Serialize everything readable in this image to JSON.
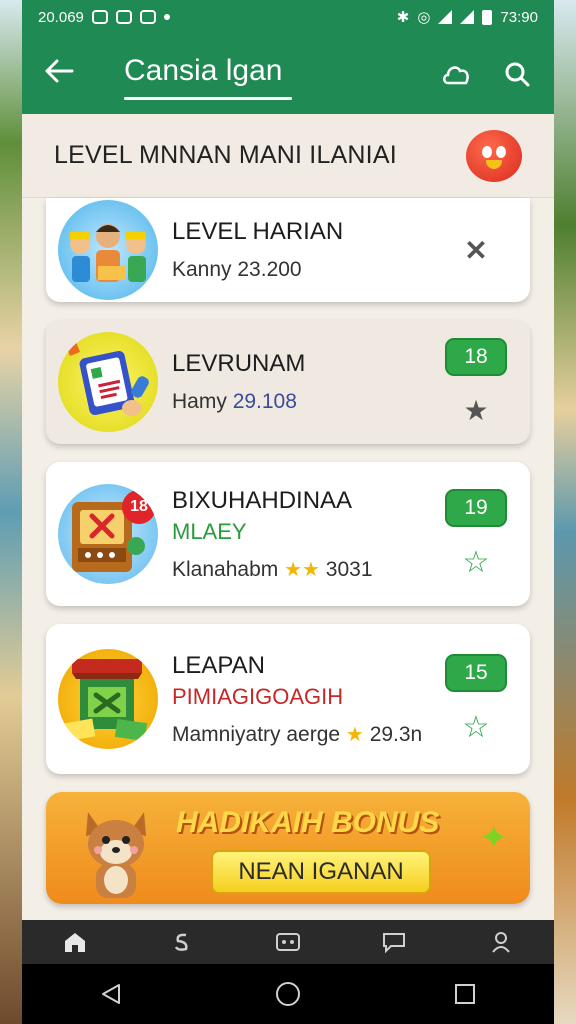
{
  "status": {
    "time": "20.069",
    "clock": "73:90"
  },
  "appbar": {
    "title": "Cansia lgan"
  },
  "section": {
    "title": "LEVEL MNNAN MANI ILANIAI"
  },
  "cards": [
    {
      "title": "LEVEL HARIAN",
      "subtitle": "",
      "meta": "Kanny 23.200",
      "badge": "",
      "action": "close"
    },
    {
      "title": "LEVRUNAM",
      "subtitle": "",
      "meta_label": "Hamy",
      "meta_value": "29.108",
      "badge": "18",
      "action": "star-filled"
    },
    {
      "title": "BIXUHAHDINAA",
      "subtitle": "MLAEY",
      "meta": "Klanahabm",
      "meta_value": "3031",
      "badge": "19",
      "action": "star-outline",
      "corner_badge": "18"
    },
    {
      "title": "LEAPAN",
      "subtitle": "PIMIAGIGOAGIH",
      "meta": "Mamniyatry aerge",
      "meta_value": "29.3n",
      "badge": "15",
      "action": "star-outline"
    }
  ],
  "bonus": {
    "title": "HADIKAIH BONUS",
    "button": "NEAN IGANAN"
  },
  "colors": {
    "primary": "#1f8a54",
    "badge_green": "#2fa84a",
    "bonus_orange": "#ef8b1c"
  }
}
